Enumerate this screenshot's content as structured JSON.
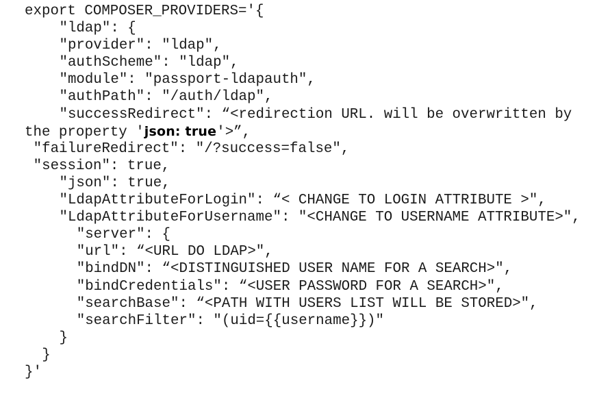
{
  "document": {
    "kind": "terminal-code-snippet",
    "background_color": "#ffffff",
    "text_color": "#1b1b1b",
    "font_style": "monospace",
    "line_count": 21
  },
  "code": {
    "lines": [
      {
        "id": "l01",
        "indent": 0,
        "text": "export COMPOSER_PROVIDERS='{"
      },
      {
        "id": "l02",
        "indent": 4,
        "text": "\"ldap\": {"
      },
      {
        "id": "l03",
        "indent": 4,
        "text": "\"provider\": \"ldap\","
      },
      {
        "id": "l04",
        "indent": 4,
        "text": "\"authScheme\": \"ldap\","
      },
      {
        "id": "l05",
        "indent": 4,
        "text": "\"module\": \"passport-ldapauth\","
      },
      {
        "id": "l06",
        "indent": 4,
        "text": "\"authPath\": \"/auth/ldap\","
      },
      {
        "id": "l07",
        "indent": 4,
        "text": "\"successRedirect\": “<redirection URL. will be overwritten by"
      },
      {
        "id": "l08",
        "indent": 0,
        "pre": "the property '",
        "emph": "json: true",
        "post": "'>”,",
        "text": "the property 'json: true'>”,"
      },
      {
        "id": "l09",
        "indent": 1,
        "text": "\"failureRedirect\": \"/?success=false\","
      },
      {
        "id": "l10",
        "indent": 1,
        "text": "\"session\": true,"
      },
      {
        "id": "l11",
        "indent": 4,
        "text": "\"json\": true,"
      },
      {
        "id": "l12",
        "indent": 4,
        "text": "\"LdapAttributeForLogin\": “< CHANGE TO LOGIN ATTRIBUTE >\","
      },
      {
        "id": "l13",
        "indent": 4,
        "text": "\"LdapAttributeForUsername\": \"<CHANGE TO USERNAME ATTRIBUTE>\","
      },
      {
        "id": "l14",
        "indent": 6,
        "text": "\"server\": {"
      },
      {
        "id": "l15",
        "indent": 6,
        "text": "\"url\": “<URL DO LDAP>\","
      },
      {
        "id": "l16",
        "indent": 6,
        "text": "\"bindDN\": “<DISTINGUISHED USER NAME FOR A SEARCH>\","
      },
      {
        "id": "l17",
        "indent": 6,
        "text": "\"bindCredentials\": “<USER PASSWORD FOR A SEARCH>\","
      },
      {
        "id": "l18",
        "indent": 6,
        "text": "\"searchBase\": “<PATH WITH USERS LIST WILL BE STORED>\","
      },
      {
        "id": "l19",
        "indent": 6,
        "text": "\"searchFilter\": \"(uid={{username}})\""
      },
      {
        "id": "l20",
        "indent": 4,
        "text": "}"
      },
      {
        "id": "l21",
        "indent": 2,
        "text": "}"
      },
      {
        "id": "l22",
        "indent": 0,
        "text": "}'"
      }
    ],
    "emphasis": {
      "text": "json: true",
      "style": "bold",
      "quoted_as": "'json: true'"
    }
  }
}
